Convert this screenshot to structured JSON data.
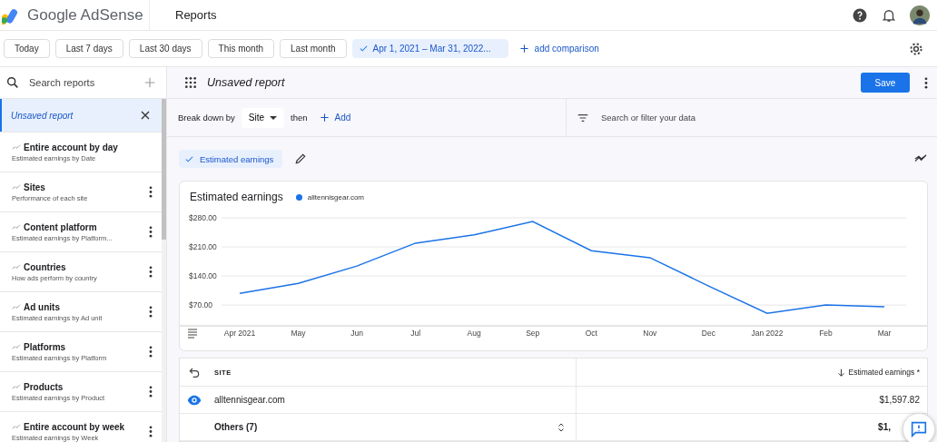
{
  "header": {
    "product": "Google AdSense",
    "page_title": "Reports"
  },
  "date_chips": [
    {
      "label": "Today",
      "selected": false
    },
    {
      "label": "Last 7 days",
      "selected": false
    },
    {
      "label": "Last 30 days",
      "selected": false
    },
    {
      "label": "This month",
      "selected": false
    },
    {
      "label": "Last month",
      "selected": false
    },
    {
      "label": "Apr 1, 2021 – Mar 31, 2022...",
      "selected": true
    }
  ],
  "add_comparison": "add comparison",
  "sidebar": {
    "search_placeholder": "Search reports",
    "items": [
      {
        "title": "Unsaved report",
        "selected": true,
        "kind": "current"
      },
      {
        "title": "Entire account by day",
        "subtitle": "Estimated earnings by Date",
        "selected": false,
        "kind": "saved",
        "has_menu": false
      },
      {
        "title": "Sites",
        "subtitle": "Performance of each site",
        "selected": false,
        "kind": "saved",
        "has_menu": true
      },
      {
        "title": "Content platform",
        "subtitle": "Estimated earnings by Platform...",
        "selected": false,
        "kind": "saved",
        "has_menu": true
      },
      {
        "title": "Countries",
        "subtitle": "How ads perform by country",
        "selected": false,
        "kind": "saved",
        "has_menu": true
      },
      {
        "title": "Ad units",
        "subtitle": "Estimated earnings by Ad unit",
        "selected": false,
        "kind": "saved",
        "has_menu": true
      },
      {
        "title": "Platforms",
        "subtitle": "Estimated earnings by Platform",
        "selected": false,
        "kind": "saved",
        "has_menu": true
      },
      {
        "title": "Products",
        "subtitle": "Estimated earnings by Product",
        "selected": false,
        "kind": "saved",
        "has_menu": true
      },
      {
        "title": "Entire account by week",
        "subtitle": "Estimated earnings by Week",
        "selected": false,
        "kind": "saved",
        "has_menu": true
      }
    ]
  },
  "report": {
    "title": "Unsaved report",
    "save": "Save",
    "breakdown_label": "Break down by",
    "breakdown_value": "Site",
    "then": "then",
    "add": "Add",
    "filter_placeholder": "Search or filter your data",
    "metric_chip": {
      "label": "Estimated earnings",
      "selected": true
    }
  },
  "chart": {
    "title": "Estimated earnings",
    "chart_data": {
      "type": "line",
      "categories": [
        "Apr 2021",
        "May",
        "Jun",
        "Jul",
        "Aug",
        "Sep",
        "Oct",
        "Nov",
        "Dec",
        "Jan 2022",
        "Feb",
        "Mar"
      ],
      "series": [
        {
          "name": "alltennisgear.com",
          "color": "#1a73e8",
          "values": [
            98,
            122,
            164,
            219,
            239,
            271,
            201,
            184,
            116,
            50,
            70,
            66
          ]
        }
      ],
      "grid": true,
      "ylim": [
        20,
        280
      ],
      "yticks": [
        {
          "value": 70,
          "label": "$70.00"
        },
        {
          "value": 140,
          "label": "$140.00"
        },
        {
          "value": 210,
          "label": "$210.00"
        },
        {
          "value": 280,
          "label": "$280.00"
        }
      ]
    }
  },
  "table": {
    "columns": [
      "SITE",
      "Estimated earnings *"
    ],
    "rows": [
      {
        "kind": "site",
        "site": "alltennisgear.com",
        "earnings": "$1,597.82"
      },
      {
        "kind": "others",
        "site": "Others (7)",
        "earnings": "$1,"
      }
    ]
  }
}
